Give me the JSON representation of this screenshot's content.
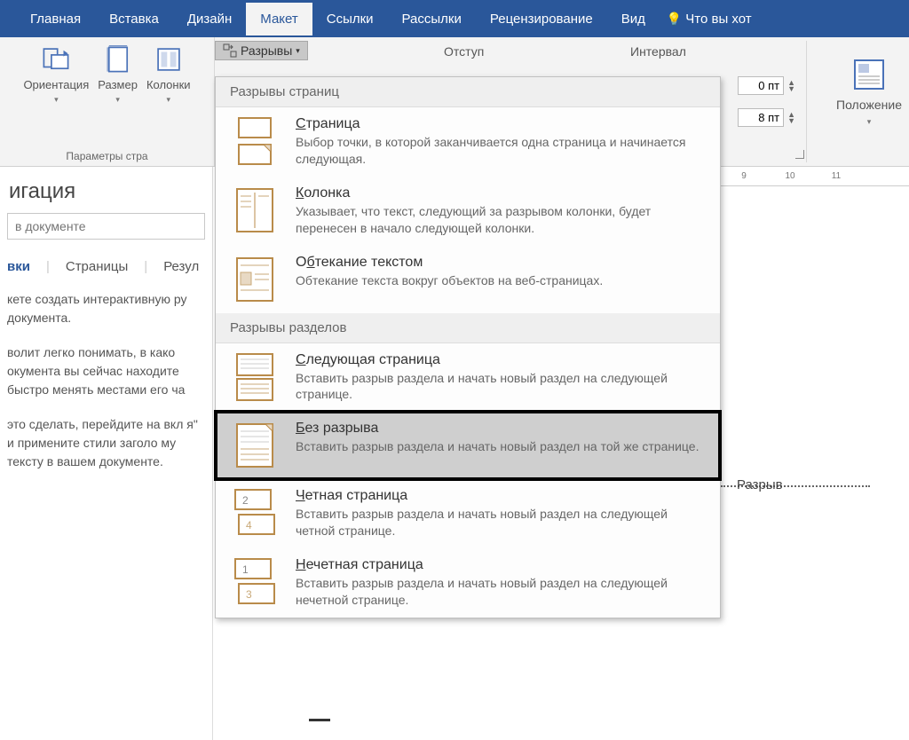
{
  "ribbon": {
    "tabs": [
      "Главная",
      "Вставка",
      "Дизайн",
      "Макет",
      "Ссылки",
      "Рассылки",
      "Рецензирование",
      "Вид"
    ],
    "active_tab_index": 3,
    "tell_me": "Что вы хот",
    "orientation": "Ориентация",
    "size": "Размер",
    "columns": "Колонки",
    "page_setup_group": "Параметры стра",
    "breaks_button": "Разрывы",
    "indent_label": "Отступ",
    "spacing_label": "Интервал",
    "spacing_before": "0 пт",
    "spacing_after": "8 пт",
    "position": "Положение"
  },
  "nav": {
    "title": "игация",
    "search_placeholder": "в документе",
    "tabs": [
      "вки",
      "Страницы",
      "Резул"
    ],
    "active_tab_index": 0,
    "body": [
      "кете создать интерактивную ру документа.",
      "волит легко понимать, в како окумента вы сейчас находите быстро менять местами его ча",
      "это сделать, перейдите на вкл я\" и примените стили заголо му тексту в вашем документе."
    ]
  },
  "ruler_ticks": [
    "9",
    "10",
    "11"
  ],
  "menu": {
    "section1": "Разрывы страниц",
    "section2": "Разрывы разделов",
    "items": [
      {
        "title": "Страница",
        "u": "С",
        "desc": "Выбор точки, в которой заканчивается одна страница и начинается следующая."
      },
      {
        "title": "Колонка",
        "u": "К",
        "desc": "Указывает, что текст, следующий за разрывом колонки, будет перенесен в начало следующей колонки."
      },
      {
        "title": "Обтекание текстом",
        "u": "б",
        "desc": "Обтекание текста вокруг объектов на веб-страницах."
      },
      {
        "title": "Следующая страница",
        "u": "С",
        "desc": "Вставить разрыв раздела и начать новый раздел на следующей странице."
      },
      {
        "title": "Без разрыва",
        "u": "Б",
        "desc": "Вставить разрыв раздела и начать новый раздел на той же странице."
      },
      {
        "title": "Четная страница",
        "u": "Ч",
        "desc": "Вставить разрыв раздела и начать новый раздел на следующей четной странице."
      },
      {
        "title": "Нечетная страница",
        "u": "Н",
        "desc": "Вставить разрыв раздела и начать новый раздел на следующей нечетной странице."
      }
    ]
  },
  "annotation": "Разрыв"
}
